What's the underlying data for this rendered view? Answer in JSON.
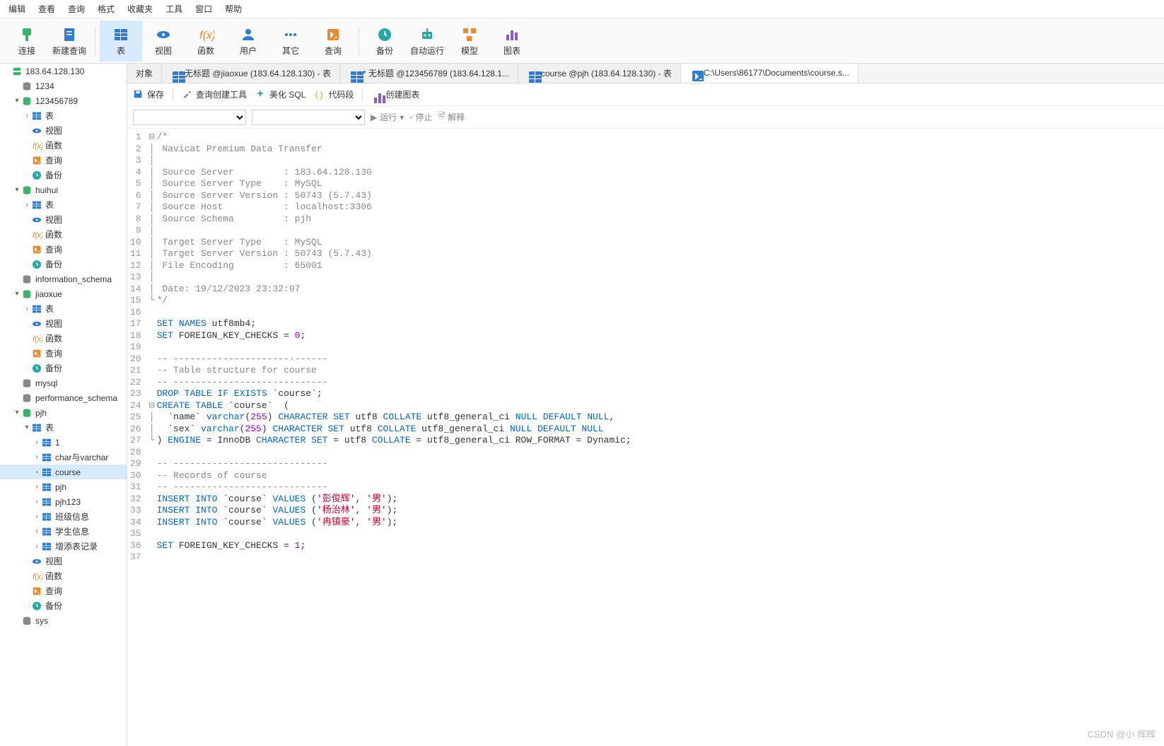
{
  "ribbonMenu": [
    "编辑",
    "查看",
    "查询",
    "格式",
    "收藏夹",
    "工具",
    "窗口",
    "帮助"
  ],
  "toolbar": [
    {
      "label": "连接",
      "icon": "plug",
      "color": "c-green"
    },
    {
      "label": "新建查询",
      "icon": "doc",
      "color": "c-blue"
    },
    {
      "label": "表",
      "icon": "table",
      "color": "c-blue",
      "active": true
    },
    {
      "label": "视图",
      "icon": "view",
      "color": "c-blue"
    },
    {
      "label": "函数",
      "icon": "fx",
      "color": "c-orange"
    },
    {
      "label": "用户",
      "icon": "user",
      "color": "c-blue"
    },
    {
      "label": "其它",
      "icon": "dots",
      "color": "c-blue"
    },
    {
      "label": "查询",
      "icon": "query",
      "color": "c-orange"
    },
    {
      "label": "备份",
      "icon": "backup",
      "color": "c-teal"
    },
    {
      "label": "自动运行",
      "icon": "robot",
      "color": "c-teal"
    },
    {
      "label": "模型",
      "icon": "model",
      "color": "c-orange"
    },
    {
      "label": "图表",
      "icon": "chart",
      "color": "c-purple"
    }
  ],
  "toolbarSeps": [
    2,
    8
  ],
  "sidebar": [
    {
      "d": 0,
      "a": "",
      "i": "server",
      "c": "c-green",
      "l": "183.64.128.130"
    },
    {
      "d": 1,
      "a": "",
      "i": "db",
      "c": "c-gray",
      "l": "1234"
    },
    {
      "d": 1,
      "a": "▾",
      "i": "db",
      "c": "c-green",
      "l": "123456789"
    },
    {
      "d": 2,
      "a": "›",
      "i": "table",
      "c": "c-blue",
      "l": "表"
    },
    {
      "d": 2,
      "a": "",
      "i": "view",
      "c": "c-blue",
      "l": "视图"
    },
    {
      "d": 2,
      "a": "",
      "i": "fx",
      "c": "c-orange",
      "l": "函数"
    },
    {
      "d": 2,
      "a": "",
      "i": "query",
      "c": "c-orange",
      "l": "查询"
    },
    {
      "d": 2,
      "a": "",
      "i": "backup",
      "c": "c-teal",
      "l": "备份"
    },
    {
      "d": 1,
      "a": "▾",
      "i": "db",
      "c": "c-green",
      "l": "huihui"
    },
    {
      "d": 2,
      "a": "›",
      "i": "table",
      "c": "c-blue",
      "l": "表"
    },
    {
      "d": 2,
      "a": "",
      "i": "view",
      "c": "c-blue",
      "l": "视图"
    },
    {
      "d": 2,
      "a": "",
      "i": "fx",
      "c": "c-orange",
      "l": "函数"
    },
    {
      "d": 2,
      "a": "",
      "i": "query",
      "c": "c-orange",
      "l": "查询"
    },
    {
      "d": 2,
      "a": "",
      "i": "backup",
      "c": "c-teal",
      "l": "备份"
    },
    {
      "d": 1,
      "a": "",
      "i": "db",
      "c": "c-gray",
      "l": "information_schema"
    },
    {
      "d": 1,
      "a": "▾",
      "i": "db",
      "c": "c-green",
      "l": "jiaoxue"
    },
    {
      "d": 2,
      "a": "›",
      "i": "table",
      "c": "c-blue",
      "l": "表"
    },
    {
      "d": 2,
      "a": "",
      "i": "view",
      "c": "c-blue",
      "l": "视图"
    },
    {
      "d": 2,
      "a": "",
      "i": "fx",
      "c": "c-orange",
      "l": "函数"
    },
    {
      "d": 2,
      "a": "",
      "i": "query",
      "c": "c-orange",
      "l": "查询"
    },
    {
      "d": 2,
      "a": "",
      "i": "backup",
      "c": "c-teal",
      "l": "备份"
    },
    {
      "d": 1,
      "a": "",
      "i": "db",
      "c": "c-gray",
      "l": "mysql"
    },
    {
      "d": 1,
      "a": "",
      "i": "db",
      "c": "c-gray",
      "l": "performance_schema"
    },
    {
      "d": 1,
      "a": "▾",
      "i": "db",
      "c": "c-green",
      "l": "pjh"
    },
    {
      "d": 2,
      "a": "▾",
      "i": "table",
      "c": "c-blue",
      "l": "表"
    },
    {
      "d": 3,
      "a": "›",
      "i": "table",
      "c": "c-blue",
      "l": "1"
    },
    {
      "d": 3,
      "a": "›",
      "i": "table",
      "c": "c-blue",
      "l": "char与varchar"
    },
    {
      "d": 3,
      "a": "›",
      "i": "table",
      "c": "c-blue",
      "l": "course",
      "sel": true
    },
    {
      "d": 3,
      "a": "›",
      "i": "table",
      "c": "c-blue",
      "l": "pjh"
    },
    {
      "d": 3,
      "a": "›",
      "i": "table",
      "c": "c-blue",
      "l": "pjh123"
    },
    {
      "d": 3,
      "a": "›",
      "i": "table",
      "c": "c-blue",
      "l": "班级信息"
    },
    {
      "d": 3,
      "a": "›",
      "i": "table",
      "c": "c-blue",
      "l": "学生信息"
    },
    {
      "d": 3,
      "a": "›",
      "i": "table",
      "c": "c-blue",
      "l": "增添表记录"
    },
    {
      "d": 2,
      "a": "",
      "i": "view",
      "c": "c-blue",
      "l": "视图"
    },
    {
      "d": 2,
      "a": "",
      "i": "fx",
      "c": "c-orange",
      "l": "函数"
    },
    {
      "d": 2,
      "a": "",
      "i": "query",
      "c": "c-orange",
      "l": "查询"
    },
    {
      "d": 2,
      "a": "",
      "i": "backup",
      "c": "c-teal",
      "l": "备份"
    },
    {
      "d": 1,
      "a": "",
      "i": "db",
      "c": "c-gray",
      "l": "sys"
    }
  ],
  "tabs": [
    {
      "label": "对象",
      "icon": "",
      "active": false
    },
    {
      "label": "无标题 @jiaoxue (183.64.128.130) - 表",
      "icon": "table",
      "active": false
    },
    {
      "label": "* 无标题 @123456789 (183.64.128.1...",
      "icon": "table",
      "active": false
    },
    {
      "label": "course @pjh (183.64.128.130) - 表",
      "icon": "table",
      "active": false
    },
    {
      "label": "C:\\Users\\86177\\Documents\\course.s...",
      "icon": "query",
      "active": true
    }
  ],
  "subtoolbar": [
    {
      "label": "保存",
      "icon": "save",
      "color": "c-blue"
    },
    {
      "label": "查询创建工具",
      "icon": "tool",
      "color": "c-gray"
    },
    {
      "label": "美化 SQL",
      "icon": "spark",
      "color": "c-teal"
    },
    {
      "label": "代码段",
      "icon": "brace",
      "color": "c-orange"
    },
    {
      "label": "创建图表",
      "icon": "chart",
      "color": "c-purple"
    }
  ],
  "runbar": {
    "run": "运行",
    "stop": "停止",
    "explain": "解释"
  },
  "code": [
    {
      "n": 1,
      "f": "⊟",
      "h": "<span class='cmt'>/*</span>"
    },
    {
      "n": 2,
      "f": "│",
      "h": "<span class='cmt'> Navicat Premium Data Transfer</span>"
    },
    {
      "n": 3,
      "f": "│",
      "h": ""
    },
    {
      "n": 4,
      "f": "│",
      "h": "<span class='cmt'> Source Server         : 183.64.128.130</span>"
    },
    {
      "n": 5,
      "f": "│",
      "h": "<span class='cmt'> Source Server Type    : MySQL</span>"
    },
    {
      "n": 6,
      "f": "│",
      "h": "<span class='cmt'> Source Server Version : 50743 (5.7.43)</span>"
    },
    {
      "n": 7,
      "f": "│",
      "h": "<span class='cmt'> Source Host           : localhost:3306</span>"
    },
    {
      "n": 8,
      "f": "│",
      "h": "<span class='cmt'> Source Schema         : pjh</span>"
    },
    {
      "n": 9,
      "f": "│",
      "h": ""
    },
    {
      "n": 10,
      "f": "│",
      "h": "<span class='cmt'> Target Server Type    : MySQL</span>"
    },
    {
      "n": 11,
      "f": "│",
      "h": "<span class='cmt'> Target Server Version : 50743 (5.7.43)</span>"
    },
    {
      "n": 12,
      "f": "│",
      "h": "<span class='cmt'> File Encoding         : 65001</span>"
    },
    {
      "n": 13,
      "f": "│",
      "h": ""
    },
    {
      "n": 14,
      "f": "│",
      "h": "<span class='cmt'> Date: 19/12/2023 23:32:07</span>"
    },
    {
      "n": 15,
      "f": "└",
      "h": "<span class='cmt'>*/</span>"
    },
    {
      "n": 16,
      "f": "",
      "h": ""
    },
    {
      "n": 17,
      "f": "",
      "h": "<span class='kw'>SET</span> <span class='kw'>NAMES</span> utf8mb4;"
    },
    {
      "n": 18,
      "f": "",
      "h": "<span class='kw'>SET</span> FOREIGN_KEY_CHECKS = <span class='num'>0</span>;"
    },
    {
      "n": 19,
      "f": "",
      "h": ""
    },
    {
      "n": 20,
      "f": "",
      "h": "<span class='cmt'>-- ----------------------------</span>"
    },
    {
      "n": 21,
      "f": "",
      "h": "<span class='cmt'>-- Table structure for course</span>"
    },
    {
      "n": 22,
      "f": "",
      "h": "<span class='cmt'>-- ----------------------------</span>"
    },
    {
      "n": 23,
      "f": "",
      "h": "<span class='kw'>DROP</span> <span class='kw'>TABLE</span> <span class='kw'>IF</span> <span class='kw'>EXISTS</span> `course`;"
    },
    {
      "n": 24,
      "f": "⊟",
      "h": "<span class='kw'>CREATE</span> <span class='kw'>TABLE</span> `course`  ("
    },
    {
      "n": 25,
      "f": "│",
      "h": "  `name` <span class='type'>varchar</span>(<span class='num'>255</span>) <span class='kw'>CHARACTER</span> <span class='kw'>SET</span> utf8 <span class='kw'>COLLATE</span> utf8_general_ci <span class='kw'>NULL</span> <span class='kw'>DEFAULT</span> <span class='kw'>NULL</span>,"
    },
    {
      "n": 26,
      "f": "│",
      "h": "  `sex` <span class='type'>varchar</span>(<span class='num'>255</span>) <span class='kw'>CHARACTER</span> <span class='kw'>SET</span> utf8 <span class='kw'>COLLATE</span> utf8_general_ci <span class='kw'>NULL</span> <span class='kw'>DEFAULT</span> <span class='kw'>NULL</span>"
    },
    {
      "n": 27,
      "f": "└",
      "h": ") <span class='kw'>ENGINE</span> = InnoDB <span class='kw'>CHARACTER</span> <span class='kw'>SET</span> = utf8 <span class='kw'>COLLATE</span> = utf8_general_ci ROW_FORMAT = Dynamic;"
    },
    {
      "n": 28,
      "f": "",
      "h": ""
    },
    {
      "n": 29,
      "f": "",
      "h": "<span class='cmt'>-- ----------------------------</span>"
    },
    {
      "n": 30,
      "f": "",
      "h": "<span class='cmt'>-- Records of course</span>"
    },
    {
      "n": 31,
      "f": "",
      "h": "<span class='cmt'>-- ----------------------------</span>"
    },
    {
      "n": 32,
      "f": "",
      "h": "<span class='kw'>INSERT</span> <span class='kw'>INTO</span> `course` <span class='kw'>VALUES</span> (<span class='str'>'彭俊辉'</span>, <span class='str'>'男'</span>);"
    },
    {
      "n": 33,
      "f": "",
      "h": "<span class='kw'>INSERT</span> <span class='kw'>INTO</span> `course` <span class='kw'>VALUES</span> (<span class='str'>'杨治林'</span>, <span class='str'>'男'</span>);"
    },
    {
      "n": 34,
      "f": "",
      "h": "<span class='kw'>INSERT</span> <span class='kw'>INTO</span> `course` <span class='kw'>VALUES</span> (<span class='str'>'冉镇豪'</span>, <span class='str'>'男'</span>);"
    },
    {
      "n": 35,
      "f": "",
      "h": ""
    },
    {
      "n": 36,
      "f": "",
      "h": "<span class='kw'>SET</span> FOREIGN_KEY_CHECKS = <span class='num'>1</span>;"
    },
    {
      "n": 37,
      "f": "",
      "h": ""
    }
  ],
  "watermark": "CSDN @小 辉辉"
}
